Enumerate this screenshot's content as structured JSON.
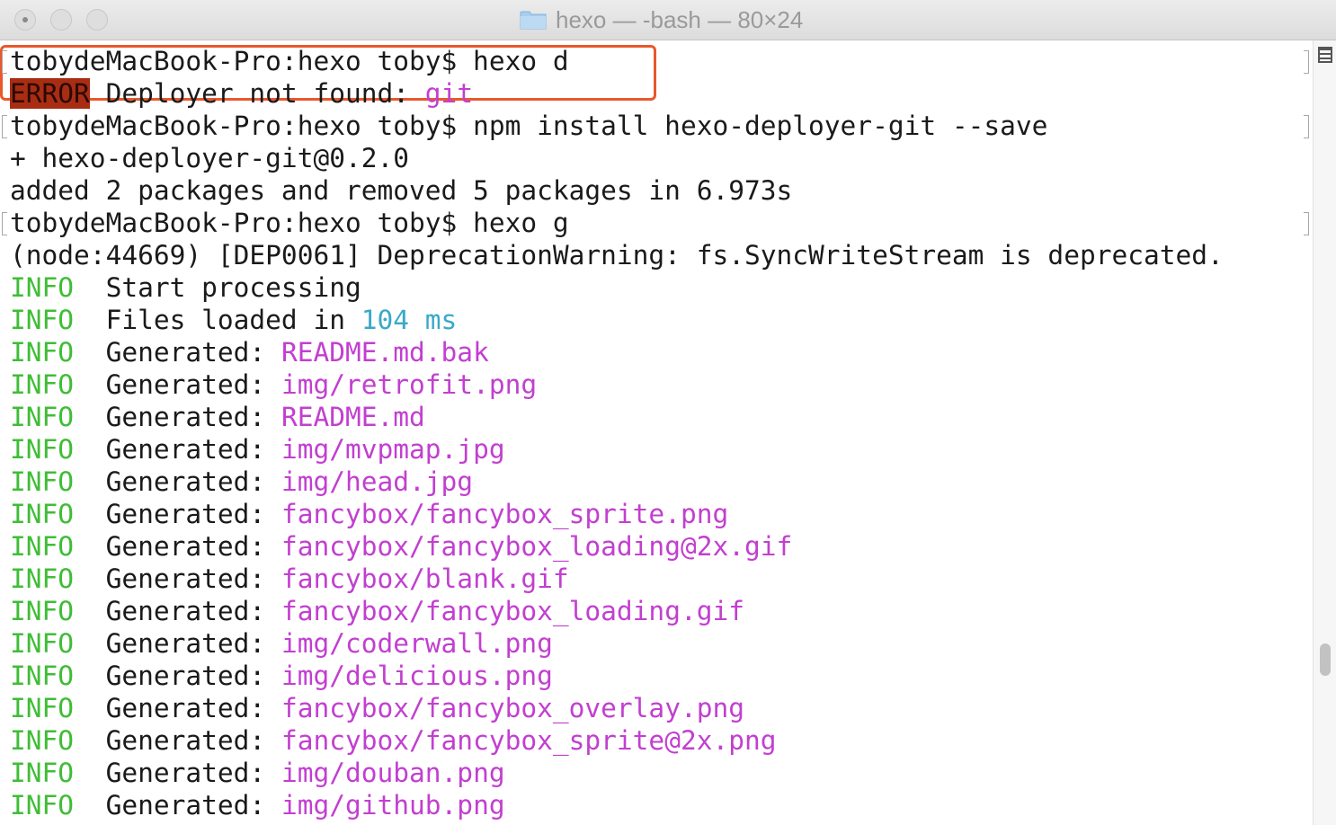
{
  "window": {
    "title": "hexo — -bash — 80×24"
  },
  "terminal": {
    "cmd1": "tobydeMacBook-Pro:hexo toby$ hexo d",
    "error_tag": "ERROR",
    "error_msg": " Deployer not found: ",
    "error_value": "git",
    "cmd2": "tobydeMacBook-Pro:hexo toby$ npm install hexo-deployer-git --save",
    "npm_out1": "+ hexo-deployer-git@0.2.0",
    "npm_out2": "added 2 packages and removed 5 packages in 6.973s",
    "cmd3": "tobydeMacBook-Pro:hexo toby$ hexo g",
    "warning": "(node:44669) [DEP0061] DeprecationWarning: fs.SyncWriteStream is deprecated.",
    "info_tag": "INFO",
    "start_msg": "  Start processing",
    "files_msg": "  Files loaded in ",
    "files_time": "104 ms",
    "generated_label": "  Generated: ",
    "generated_files": [
      "README.md.bak",
      "img/retrofit.png",
      "README.md",
      "img/mvpmap.jpg",
      "img/head.jpg",
      "fancybox/fancybox_sprite.png",
      "fancybox/fancybox_loading@2x.gif",
      "fancybox/blank.gif",
      "fancybox/fancybox_loading.gif",
      "img/coderwall.png",
      "img/delicious.png",
      "fancybox/fancybox_overlay.png",
      "fancybox/fancybox_sprite@2x.png",
      "img/douban.png",
      "img/github.png"
    ]
  },
  "colors": {
    "info": "#3fbd36",
    "path": "#c23fd0",
    "number": "#3aa9c7",
    "error_bg": "#a92d12",
    "highlight_box": "#e9582b"
  }
}
